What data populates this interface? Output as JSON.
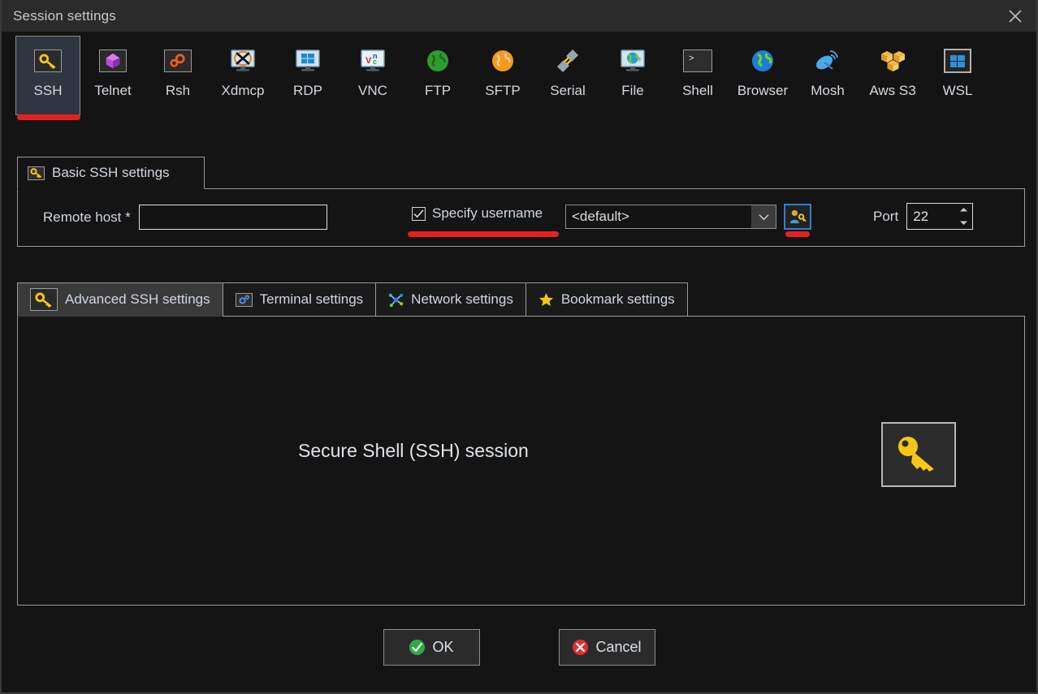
{
  "window": {
    "title": "Session settings",
    "close_icon": "close-icon"
  },
  "protocols": [
    {
      "label": "SSH",
      "icon": "key-icon",
      "selected": true
    },
    {
      "label": "Telnet",
      "icon": "purple-gem-icon",
      "selected": false
    },
    {
      "label": "Rsh",
      "icon": "orange-gears-icon",
      "selected": false
    },
    {
      "label": "Xdmcp",
      "icon": "x-monitor-icon",
      "selected": false
    },
    {
      "label": "RDP",
      "icon": "windows-monitor-icon",
      "selected": false
    },
    {
      "label": "VNC",
      "icon": "vnc-monitor-icon",
      "selected": false
    },
    {
      "label": "FTP",
      "icon": "green-globe-icon",
      "selected": false
    },
    {
      "label": "SFTP",
      "icon": "orange-globe-icon",
      "selected": false
    },
    {
      "label": "Serial",
      "icon": "plug-connector-icon",
      "selected": false
    },
    {
      "label": "File",
      "icon": "globe-monitor-icon",
      "selected": false
    },
    {
      "label": "Shell",
      "icon": "terminal-prompt-icon",
      "selected": false
    },
    {
      "label": "Browser",
      "icon": "blue-globe-icon",
      "selected": false
    },
    {
      "label": "Mosh",
      "icon": "satellite-dish-icon",
      "selected": false
    },
    {
      "label": "Aws S3",
      "icon": "aws-cubes-icon",
      "selected": false
    },
    {
      "label": "WSL",
      "icon": "windows-logo-icon",
      "selected": false
    }
  ],
  "basic_group": {
    "tab_label": "Basic SSH settings",
    "tab_icon": "key-icon",
    "remote_host_label": "Remote host *",
    "remote_host_value": "",
    "remote_host_placeholder": "",
    "specify_username_label": "Specify username",
    "specify_username_checked": "checked",
    "username_value": "<default>",
    "username_options": [
      "<default>"
    ],
    "user_button_icon": "user-key-icon",
    "port_label": "Port",
    "port_value": "22"
  },
  "settings_tabs": [
    {
      "label": "Advanced SSH settings",
      "icon": "key-icon",
      "active": true
    },
    {
      "label": "Terminal settings",
      "icon": "blue-gear-icon",
      "active": false
    },
    {
      "label": "Network settings",
      "icon": "network-node-icon",
      "active": false
    },
    {
      "label": "Bookmark settings",
      "icon": "star-icon",
      "active": false
    }
  ],
  "panel": {
    "caption": "Secure Shell (SSH) session",
    "big_icon": "key-icon"
  },
  "footer": {
    "ok_label": "OK",
    "ok_icon": "green-check-icon",
    "cancel_label": "Cancel",
    "cancel_icon": "red-x-icon"
  },
  "colors": {
    "highlight_red": "#e62020",
    "accent_blue": "#2f7fd4",
    "key_yellow": "#f5c518",
    "ok_green": "#2faa44",
    "cancel_red": "#e03030"
  }
}
